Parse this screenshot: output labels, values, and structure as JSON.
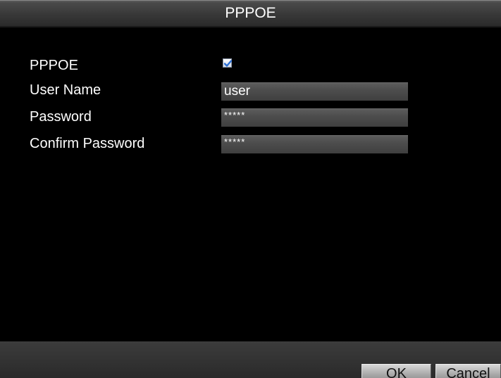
{
  "dialog": {
    "title": "PPPOE"
  },
  "form": {
    "pppoe_label": "PPPOE",
    "pppoe_enabled": true,
    "username_label": "User Name",
    "username_value": "user",
    "password_label": "Password",
    "password_value": "*****",
    "confirm_password_label": "Confirm Password",
    "confirm_password_value": "*****"
  },
  "buttons": {
    "ok_label": "OK",
    "cancel_label": "Cancel"
  },
  "icons": {
    "checkbox_check": "checkmark-icon"
  },
  "colors": {
    "background": "#000000",
    "titlebar": "#3a3a3a",
    "field": "#4d4d4d",
    "check": "#2a6fd6"
  }
}
